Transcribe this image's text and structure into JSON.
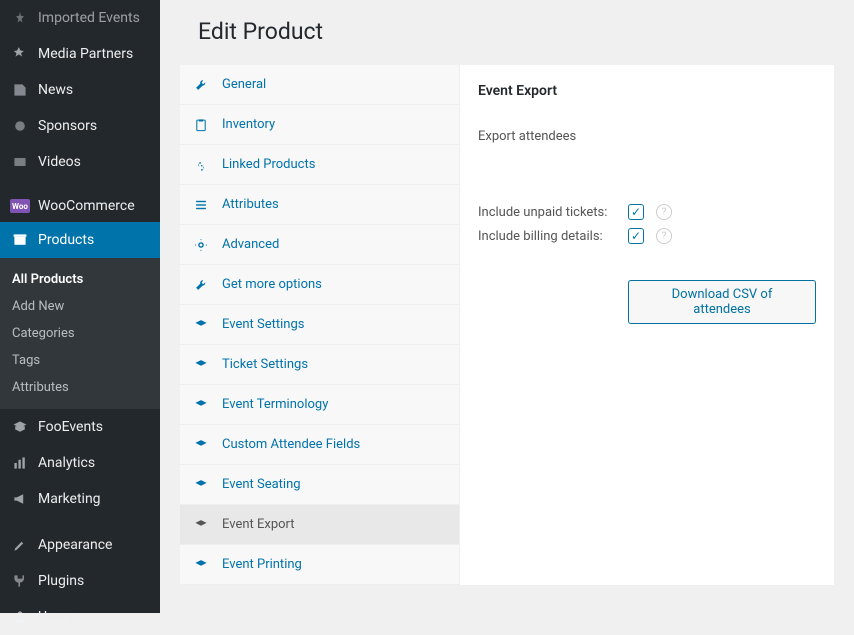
{
  "sidebar": {
    "items": [
      {
        "label": "Imported Events",
        "icon": "📌"
      },
      {
        "label": "Media Partners",
        "icon": "📌"
      },
      {
        "label": "News",
        "icon": "📌"
      },
      {
        "label": "Sponsors",
        "icon": "📌"
      },
      {
        "label": "Videos",
        "icon": "📌"
      },
      {
        "label": "WooCommerce",
        "icon": "woo"
      },
      {
        "label": "Products",
        "icon": "archive"
      },
      {
        "label": "FooEvents",
        "icon": "🎓"
      },
      {
        "label": "Analytics",
        "icon": "📊"
      },
      {
        "label": "Marketing",
        "icon": "📢"
      },
      {
        "label": "Appearance",
        "icon": "🖌"
      },
      {
        "label": "Plugins",
        "icon": "🔌"
      },
      {
        "label": "Users",
        "icon": "👤"
      }
    ],
    "submenu": [
      {
        "label": "All Products"
      },
      {
        "label": "Add New"
      },
      {
        "label": "Categories"
      },
      {
        "label": "Tags"
      },
      {
        "label": "Attributes"
      }
    ]
  },
  "page_title": "Edit Product",
  "tabs": [
    {
      "label": "General",
      "icon": "wrench"
    },
    {
      "label": "Inventory",
      "icon": "clipboard"
    },
    {
      "label": "Linked Products",
      "icon": "link"
    },
    {
      "label": "Attributes",
      "icon": "list"
    },
    {
      "label": "Advanced",
      "icon": "gear"
    },
    {
      "label": "Get more options",
      "icon": "wrench"
    },
    {
      "label": "Event Settings",
      "icon": "grad"
    },
    {
      "label": "Ticket Settings",
      "icon": "grad"
    },
    {
      "label": "Event Terminology",
      "icon": "grad"
    },
    {
      "label": "Custom Attendee Fields",
      "icon": "grad"
    },
    {
      "label": "Event Seating",
      "icon": "grad"
    },
    {
      "label": "Event Export",
      "icon": "grad"
    },
    {
      "label": "Event Printing",
      "icon": "grad"
    }
  ],
  "panel": {
    "title": "Event Export",
    "subtitle": "Export attendees",
    "fields": {
      "unpaid_label": "Include unpaid tickets:",
      "billing_label": "Include billing details:"
    },
    "button": "Download CSV of attendees"
  }
}
